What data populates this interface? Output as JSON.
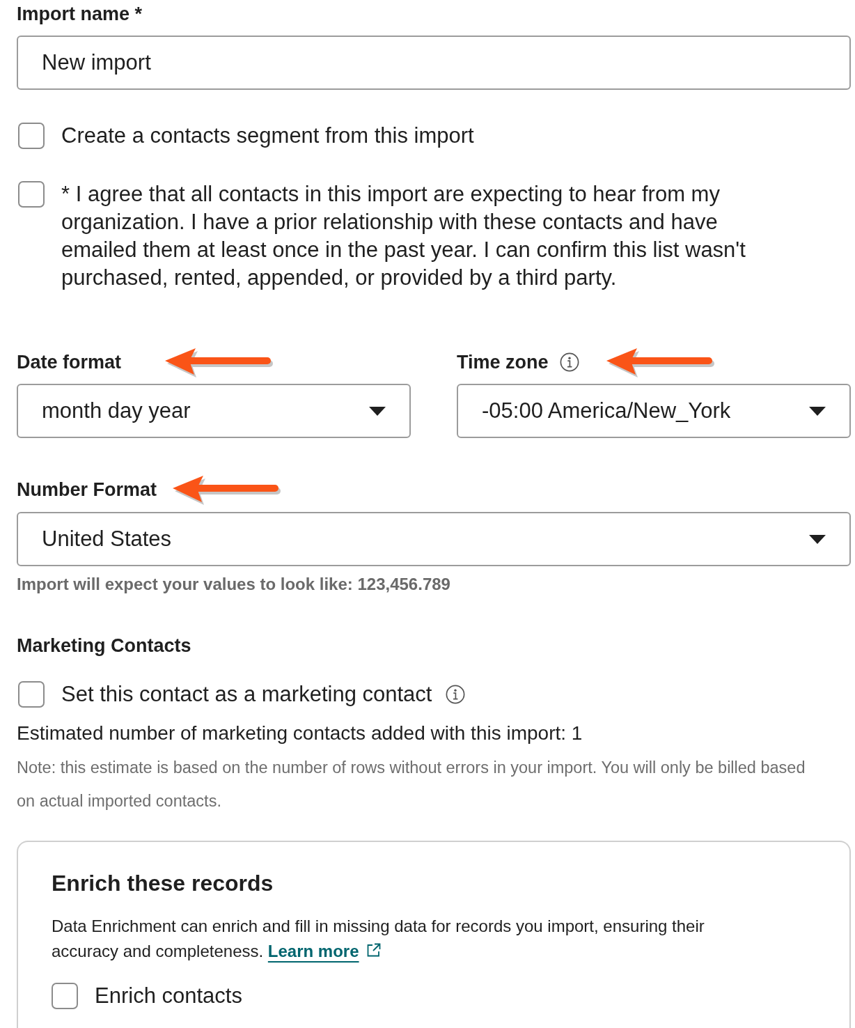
{
  "import_name": {
    "label": "Import name *",
    "value": "New import"
  },
  "options": [
    {
      "label": "Create a contacts segment from this import",
      "checked": false
    },
    {
      "label": "* I agree that all contacts in this import are expecting to hear from my organization. I have a prior relationship with these contacts and have emailed them at least once in the past year. I can confirm this list wasn't purchased, rented, appended, or provided by a third party.",
      "checked": false
    }
  ],
  "date_format": {
    "label": "Date format",
    "value": "month day year",
    "arrow": true
  },
  "time_zone": {
    "label": "Time zone",
    "value": "-05:00 America/New_York",
    "arrow": true
  },
  "number_format": {
    "label": "Number Format",
    "value": "United States",
    "arrow": true,
    "hint": "Import will expect your values to look like: 123,456.789"
  },
  "marketing": {
    "heading": "Marketing Contacts",
    "checkbox": {
      "label": "Set this contact as a marketing contact",
      "checked": false
    },
    "estimate": "Estimated number of marketing contacts added with this import: 1",
    "note": "Note: this estimate is based on the number of rows without errors in your import. You will only be billed based on actual imported contacts."
  },
  "enrich_card": {
    "title": "Enrich these records",
    "description": "Data Enrichment can enrich and fill in missing data for records you import, ensuring their accuracy and completeness.",
    "link": "Learn more",
    "checkbox": {
      "label": "Enrich contacts",
      "checked": false
    }
  }
}
